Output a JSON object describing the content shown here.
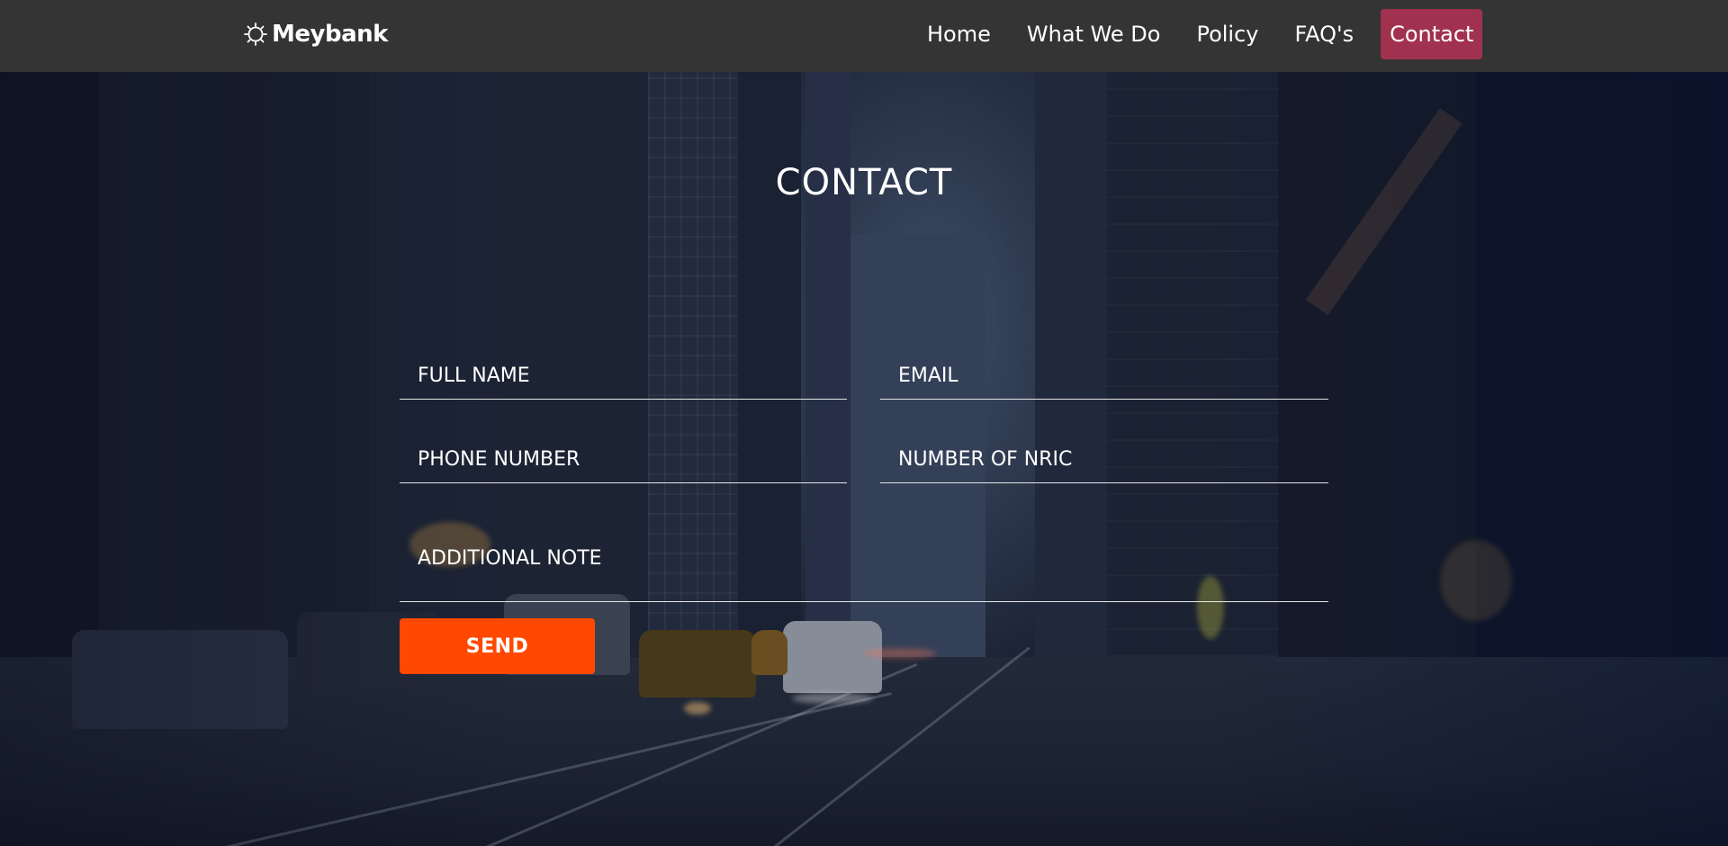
{
  "header": {
    "brand": {
      "name": "Meybank",
      "icon": "sunburst-logo-icon"
    },
    "nav": [
      {
        "label": "Home",
        "active": false
      },
      {
        "label": "What We Do",
        "active": false
      },
      {
        "label": "Policy",
        "active": false
      },
      {
        "label": "FAQ's",
        "active": false
      },
      {
        "label": "Contact",
        "active": true
      }
    ]
  },
  "contact": {
    "title": "CONTACT",
    "fields": {
      "full_name": {
        "placeholder": "FULL NAME",
        "value": ""
      },
      "email": {
        "placeholder": "EMAIL",
        "value": ""
      },
      "phone": {
        "placeholder": "PHONE NUMBER",
        "value": ""
      },
      "nric": {
        "placeholder": "NUMBER OF NRIC",
        "value": ""
      },
      "note": {
        "placeholder": "ADDITIONAL NOTE",
        "value": ""
      }
    },
    "send_label": "SEND"
  },
  "colors": {
    "header_bg": "#343434",
    "active_nav_bg": "#a0324f",
    "send_button_bg": "#ff4800",
    "text": "#ffffff"
  }
}
